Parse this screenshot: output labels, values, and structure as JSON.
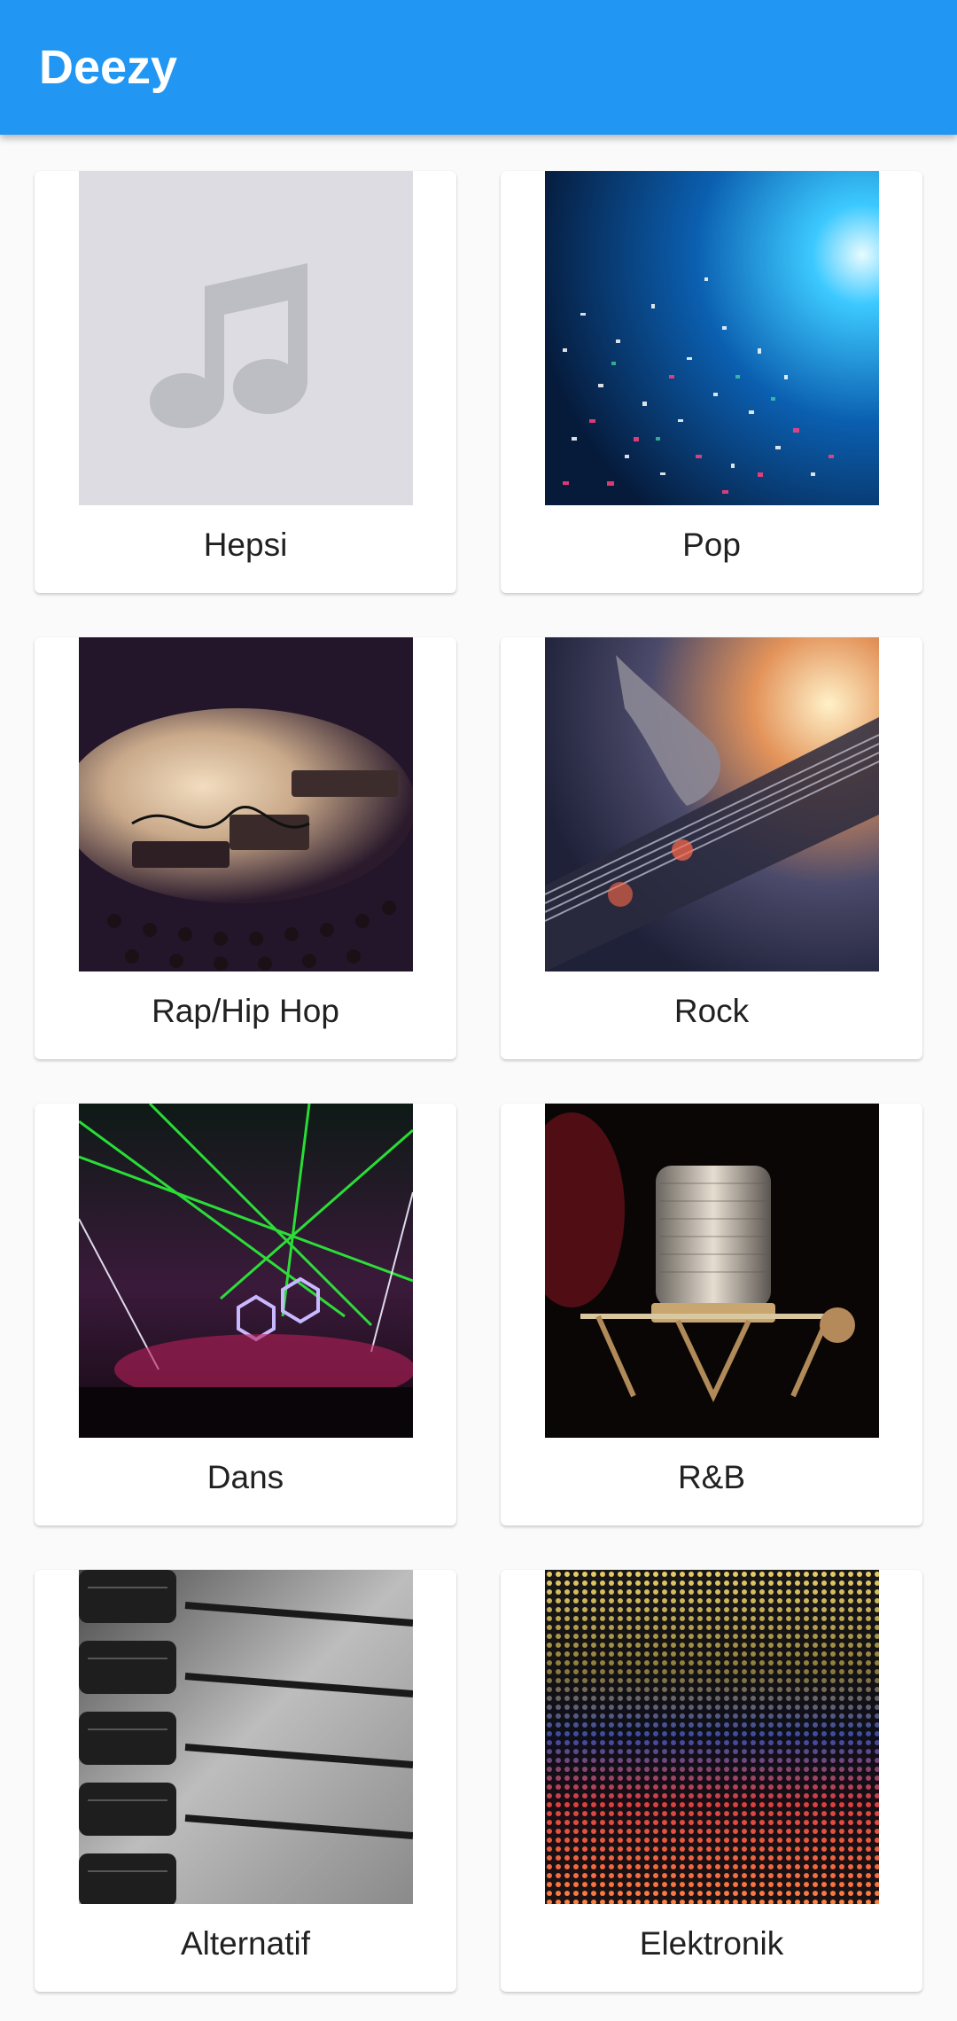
{
  "app_bar": {
    "title": "Deezy"
  },
  "genres": [
    {
      "label": "Hepsi",
      "image": "music-note-placeholder-icon"
    },
    {
      "label": "Pop",
      "image": "pop-concert-confetti-image"
    },
    {
      "label": "Rap/Hip Hop",
      "image": "dj-turntables-image"
    },
    {
      "label": "Rock",
      "image": "electric-guitar-image"
    },
    {
      "label": "Dans",
      "image": "laser-show-crowd-image"
    },
    {
      "label": "R&B",
      "image": "studio-microphone-image"
    },
    {
      "label": "Alternatif",
      "image": "mixing-console-faders-image"
    },
    {
      "label": "Elektronik",
      "image": "led-equalizer-image"
    }
  ],
  "colors": {
    "app_bar": "#2196f3",
    "background": "#fafafa",
    "card": "#ffffff",
    "placeholder": "#dcdce2"
  }
}
